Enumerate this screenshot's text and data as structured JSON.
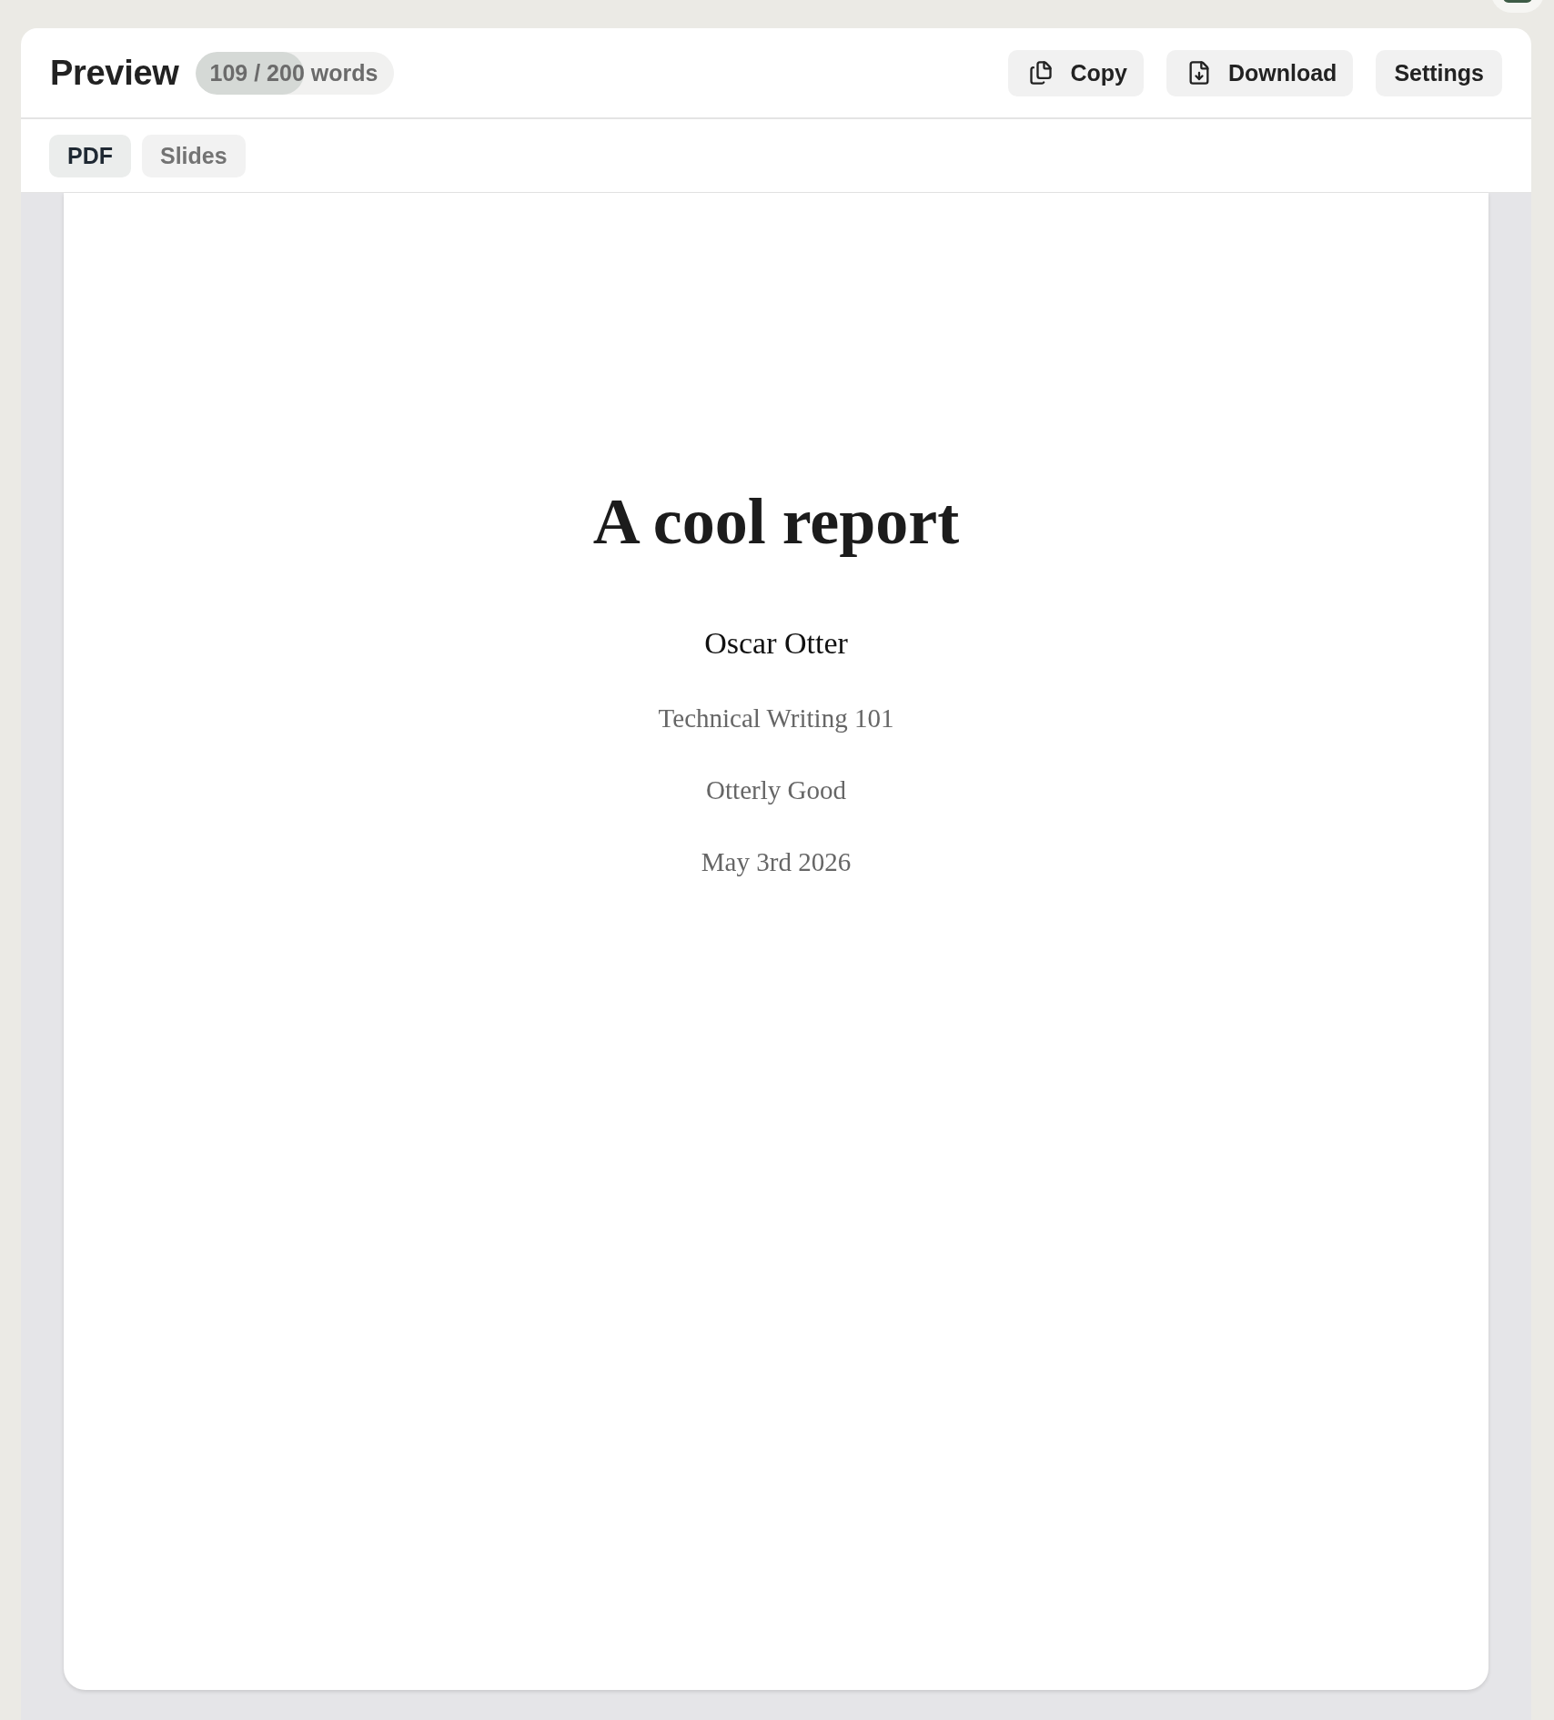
{
  "header": {
    "title": "Preview",
    "word_count": {
      "text": "109 / 200 words",
      "level": 0.545
    },
    "buttons": [
      {
        "label": "Copy",
        "kind": "copy"
      },
      {
        "label": "Download",
        "kind": "download"
      },
      {
        "label": "Settings",
        "kind": "plain"
      }
    ]
  },
  "tabs": [
    {
      "label": "PDF",
      "selected": true
    },
    {
      "label": "Slides",
      "selected": false
    }
  ],
  "document": {
    "title": "A cool report",
    "author": "Oscar Otter",
    "lines": [
      "Technical Writing 101",
      "Otterly Good",
      "May 3rd 2026"
    ]
  }
}
